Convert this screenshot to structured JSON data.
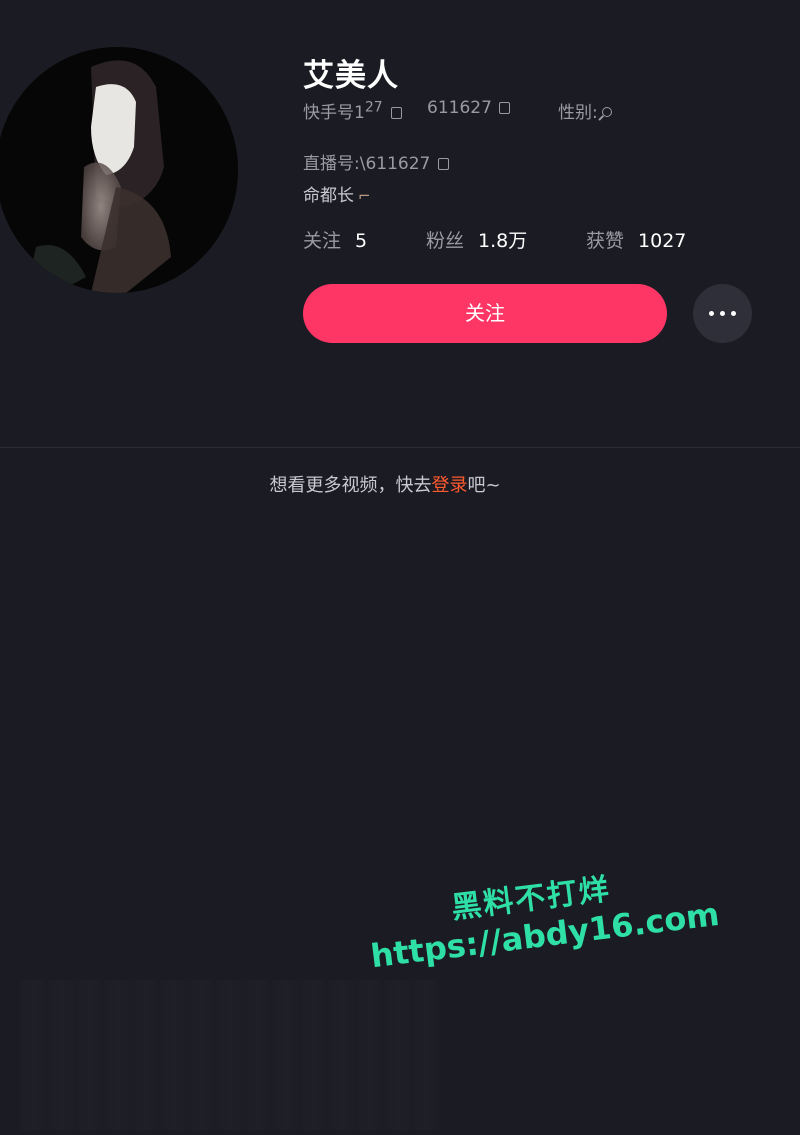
{
  "profile": {
    "name": "艾美人",
    "kuaishou_id_label": "快手号1",
    "kuaishou_id_sup": "27",
    "kuaishou_id_number": "611627",
    "gender_label": "性别:",
    "live_id_label": "直播号:",
    "live_id_value": "\\611627",
    "bio": "命都长",
    "bio_icon": "leg-emoji-icon"
  },
  "stats": {
    "follow_label": "关注",
    "follow_count": "5",
    "fans_label": "粉丝",
    "fans_count": "1.8万",
    "likes_label": "获赞",
    "likes_count": "1027"
  },
  "actions": {
    "follow_button_label": "关注",
    "more_button_icon": "more-dots-icon"
  },
  "login_prompt": {
    "before": "想看更多视频，快去",
    "link": "登录",
    "after": "吧~"
  },
  "watermark": {
    "line1": "黑料不打烊",
    "line2": "https://abdy16.com"
  },
  "colors": {
    "background": "#1b1b24",
    "follow_button": "#fe3666",
    "login_link": "#ff5a2e",
    "watermark": "#2fe0a6"
  }
}
